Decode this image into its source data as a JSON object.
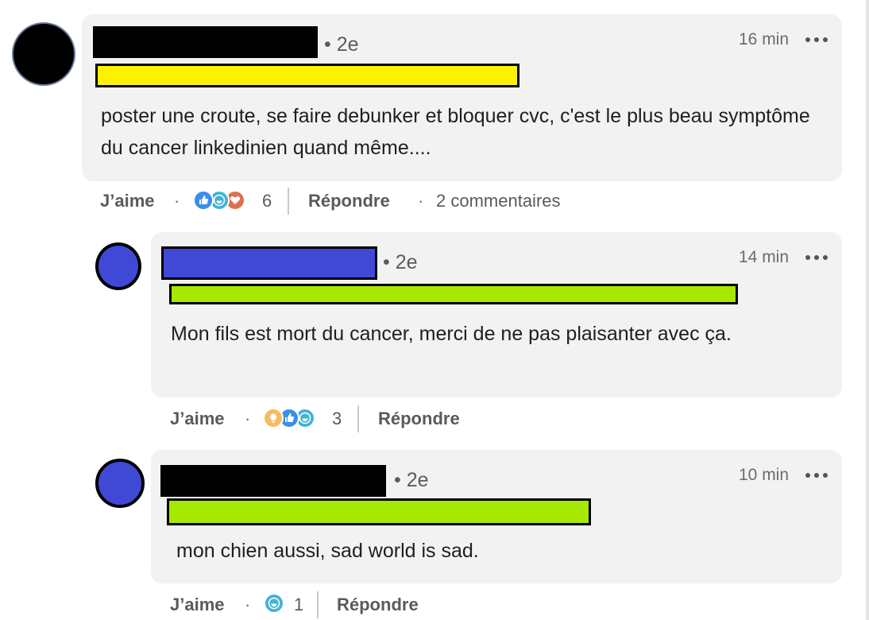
{
  "colors": {
    "bubble": "#f2f2f2",
    "redact_black": "#000000",
    "redact_yellow": "#fff200",
    "redact_green": "#a6e800",
    "redact_blue": "#3f49d6",
    "avatar_blue": "#3f49d6"
  },
  "comment": {
    "degree": "• 2e",
    "time": "16 min",
    "text": "poster une croute, se faire debunker et bloquer cvc, c'est le plus beau symptôme du cancer linkedinien quand même....",
    "like_label": "J’aime",
    "sep": "·",
    "reactions": [
      "like-icon",
      "laugh-icon",
      "love-icon"
    ],
    "reaction_count": "6",
    "reply_label": "Répondre",
    "replies_count": "2 commentaires"
  },
  "reply1": {
    "degree": "• 2e",
    "time": "14 min",
    "text": "Mon fils est mort du cancer, merci de ne pas plaisanter avec ça.",
    "like_label": "J’aime",
    "sep": "·",
    "reactions": [
      "insightful-icon",
      "like-icon",
      "laugh-icon"
    ],
    "reaction_count": "3",
    "reply_label": "Répondre"
  },
  "reply2": {
    "degree": "• 2e",
    "time": "10 min",
    "text": "mon chien aussi, sad world is sad.",
    "like_label": "J’aime",
    "sep": "·",
    "reactions": [
      "laugh-icon"
    ],
    "reaction_count": "1",
    "reply_label": "Répondre"
  }
}
